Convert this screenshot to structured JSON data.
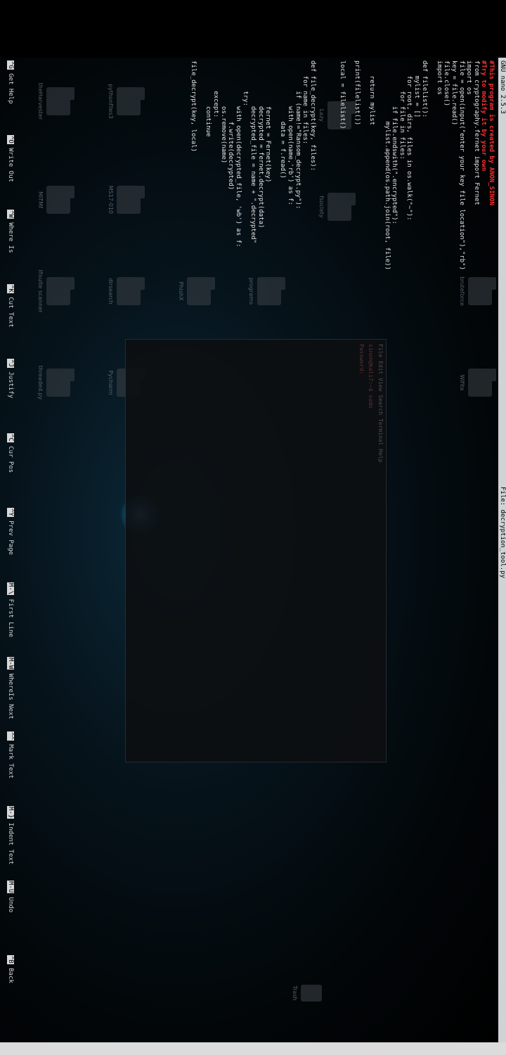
{
  "nano": {
    "version": "GNU nano 2.5.3",
    "file_label": "File: decryption_tool.py"
  },
  "editor_lines": [
    {
      "cls": "cmt",
      "text": "#This program is created by ANON_SINON"
    },
    {
      "cls": "cmt",
      "text": "#Try to modify it by your own"
    },
    {
      "cls": "plain",
      "text": "from cryptography.fernet import Fernet"
    },
    {
      "cls": "plain",
      "text": "import os"
    },
    {
      "cls": "plain",
      "text": "file = open(input(\"enter your key file location\"),\"rb\")"
    },
    {
      "cls": "plain",
      "text": "key = file.read()"
    },
    {
      "cls": "plain",
      "text": "file.close()"
    },
    {
      "cls": "plain",
      "text": "import os"
    },
    {
      "cls": "plain",
      "text": ""
    },
    {
      "cls": "plain",
      "text": "def filelist():"
    },
    {
      "cls": "plain",
      "text": "    mylist = []"
    },
    {
      "cls": "plain",
      "text": "    for root, dirs, files in os.walk(\"~\"):"
    },
    {
      "cls": "plain",
      "text": "        for file in files:"
    },
    {
      "cls": "plain",
      "text": "            if file.endswith(\".encrypted\"):"
    },
    {
      "cls": "plain",
      "text": "                mylist.append(os.path.join(root, file))"
    },
    {
      "cls": "plain",
      "text": ""
    },
    {
      "cls": "plain",
      "text": "    return mylist"
    },
    {
      "cls": "plain",
      "text": ""
    },
    {
      "cls": "plain",
      "text": "print(filelist())"
    },
    {
      "cls": "plain",
      "text": ""
    },
    {
      "cls": "plain",
      "text": "local = filelist()"
    },
    {
      "cls": "plain",
      "text": ""
    },
    {
      "cls": "plain",
      "text": ""
    },
    {
      "cls": "plain",
      "text": ""
    },
    {
      "cls": "plain",
      "text": "def file_decrypt(key, files):"
    },
    {
      "cls": "plain",
      "text": "    for name in files:"
    },
    {
      "cls": "plain",
      "text": "        if (name!=\"Ransom_decrypt.py\"):"
    },
    {
      "cls": "plain",
      "text": "            with open(name,'rb') as f:"
    },
    {
      "cls": "plain",
      "text": "                data = f.read()"
    },
    {
      "cls": "plain",
      "text": ""
    },
    {
      "cls": "plain",
      "text": "            fernet = Fernet(key)"
    },
    {
      "cls": "plain",
      "text": "            decrypted = fernet.decrypt(data)"
    },
    {
      "cls": "plain",
      "text": "            decrypted_file = name + \".decrypted\""
    },
    {
      "cls": "plain",
      "text": "        try:"
    },
    {
      "cls": "plain",
      "text": "            with open(decrypted_file, 'wb') as f:"
    },
    {
      "cls": "plain",
      "text": "                f.write(decrypted)"
    },
    {
      "cls": "plain",
      "text": "            os.remove(name)"
    },
    {
      "cls": "plain",
      "text": "        except:"
    },
    {
      "cls": "plain",
      "text": "            continue"
    },
    {
      "cls": "plain",
      "text": ""
    },
    {
      "cls": "plain",
      "text": "file_decrypt(key, local)"
    }
  ],
  "shortcuts": [
    {
      "key": "^G",
      "label": "Get Help"
    },
    {
      "key": "^O",
      "label": "Write Out"
    },
    {
      "key": "^W",
      "label": "Where Is"
    },
    {
      "key": "^K",
      "label": "Cut Text"
    },
    {
      "key": "^J",
      "label": "Justify"
    },
    {
      "key": "^C",
      "label": "Cur Pos"
    },
    {
      "key": "^Y",
      "label": "Prev Page"
    },
    {
      "key": "M-\\",
      "label": "First Line"
    },
    {
      "key": "M-W",
      "label": "WhereIs Next"
    },
    {
      "key": "^^",
      "label": "Mark Text"
    },
    {
      "key": "M-}",
      "label": "Indent Text"
    },
    {
      "key": "M-U",
      "label": "Undo"
    },
    {
      "key": "^B",
      "label": "Back"
    }
  ],
  "desktop_icons": [
    {
      "label": "Wifite"
    },
    {
      "label": "bruteforce"
    },
    {
      "label": "Lazy"
    },
    {
      "label": "fsociety"
    },
    {
      "label": "programs"
    },
    {
      "label": "PhishX"
    },
    {
      "label": "theHarvester"
    },
    {
      "label": "pythonfiles3"
    },
    {
      "label": "MS17-010"
    },
    {
      "label": "dirsearch"
    },
    {
      "label": "lfisuite scanner"
    },
    {
      "label": "MITMf"
    },
    {
      "label": "Pycharm"
    },
    {
      "label": "threaded.py"
    }
  ],
  "trash_label": "Trash",
  "dark_window": {
    "menu": "File Edit View Search Terminal Help",
    "prompt": "sinon@kali7:~$ sudo",
    "password": "Password:"
  }
}
